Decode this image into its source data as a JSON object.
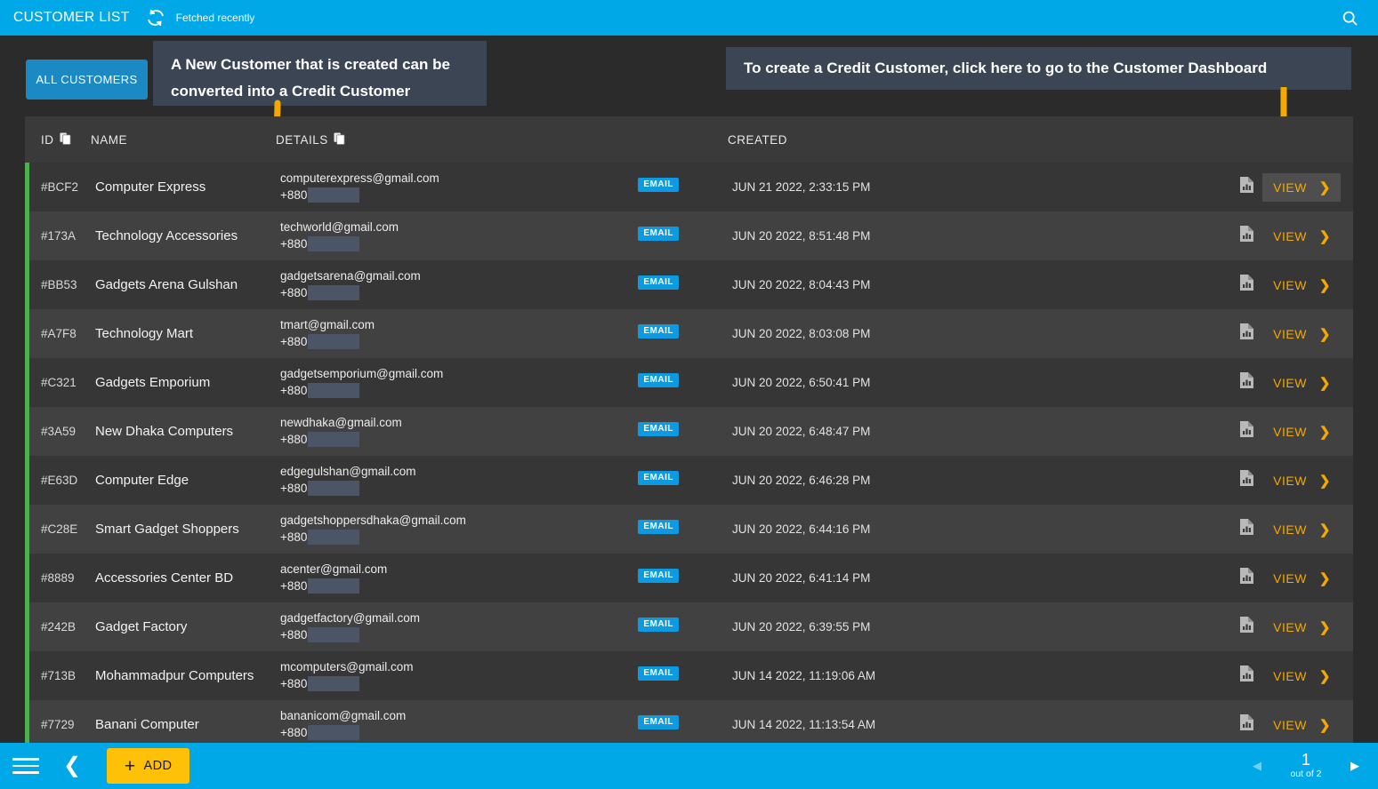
{
  "topbar": {
    "title": "CUSTOMER LIST",
    "refresh_icon": "refresh-icon",
    "fetch_status": "Fetched recently",
    "search_icon": "search-icon"
  },
  "filters": {
    "all_customers_label": "ALL CUSTOMERS"
  },
  "callouts": {
    "left": "A New Customer that is created can be converted into a Credit Customer",
    "right": "To create a Credit Customer, click here to go to the Customer Dashboard"
  },
  "table": {
    "columns": {
      "id": "ID",
      "name": "NAME",
      "details": "DETAILS",
      "created": "CREATED"
    },
    "copy_icon": "copy-icon",
    "phone_prefix": "+880",
    "email_badge": "EMAIL",
    "view_label": "VIEW",
    "report_icon": "report-chart-icon",
    "chevron_icon": "chevron-right-icon",
    "rows": [
      {
        "id": "#BCF2",
        "name": "Computer Express",
        "email": "computerexpress@gmail.com",
        "created": "JUN 21 2022, 2:33:15 PM"
      },
      {
        "id": "#173A",
        "name": "Technology Accessories",
        "email": "techworld@gmail.com",
        "created": "JUN 20 2022, 8:51:48 PM"
      },
      {
        "id": "#BB53",
        "name": "Gadgets Arena Gulshan",
        "email": "gadgetsarena@gmail.com",
        "created": "JUN 20 2022, 8:04:43 PM"
      },
      {
        "id": "#A7F8",
        "name": "Technology Mart",
        "email": "tmart@gmail.com",
        "created": "JUN 20 2022, 8:03:08 PM"
      },
      {
        "id": "#C321",
        "name": "Gadgets Emporium",
        "email": "gadgetsemporium@gmail.com",
        "created": "JUN 20 2022, 6:50:41 PM"
      },
      {
        "id": "#3A59",
        "name": "New Dhaka Computers",
        "email": "newdhaka@gmail.com",
        "created": "JUN 20 2022, 6:48:47 PM"
      },
      {
        "id": "#E63D",
        "name": "Computer Edge",
        "email": "edgegulshan@gmail.com",
        "created": "JUN 20 2022, 6:46:28 PM"
      },
      {
        "id": "#C28E",
        "name": "Smart Gadget Shoppers",
        "email": "gadgetshoppersdhaka@gmail.com",
        "created": "JUN 20 2022, 6:44:16 PM"
      },
      {
        "id": "#8889",
        "name": "Accessories Center BD",
        "email": "acenter@gmail.com",
        "created": "JUN 20 2022, 6:41:14 PM"
      },
      {
        "id": "#242B",
        "name": "Gadget Factory",
        "email": "gadgetfactory@gmail.com",
        "created": "JUN 20 2022, 6:39:55 PM"
      },
      {
        "id": "#713B",
        "name": "Mohammadpur Computers",
        "email": "mcomputers@gmail.com",
        "created": "JUN 14 2022, 11:19:06 AM"
      },
      {
        "id": "#7729",
        "name": "Banani Computer",
        "email": "bananicom@gmail.com",
        "created": "JUN 14 2022, 11:13:54 AM"
      }
    ]
  },
  "bottombar": {
    "menu_icon": "hamburger-menu-icon",
    "back_icon": "chevron-left-icon",
    "add_label": "ADD",
    "add_icon": "plus-icon",
    "pager": {
      "prev_icon": "triangle-left-icon",
      "next_icon": "triangle-right-icon",
      "current": "1",
      "total_label": "out of 2"
    }
  },
  "colors": {
    "accent_blue": "#00a8e8",
    "button_blue": "#1b89c4",
    "accent_yellow": "#f5a800",
    "add_yellow": "#ffc107",
    "row_accent_green": "#4caf50",
    "callout_bg": "#3c4553",
    "page_bg": "#2b2b2b"
  }
}
